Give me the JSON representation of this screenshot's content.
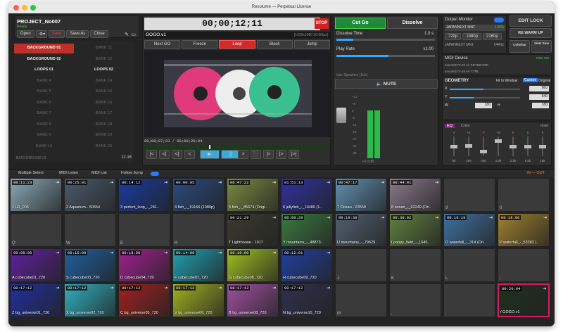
{
  "window": {
    "title": "Resolume — Perpetual License"
  },
  "project": {
    "name": "PROJECT_No007",
    "status": "Ready",
    "buttons": [
      "Open",
      "Save",
      "Save As",
      "Close"
    ]
  },
  "banks": {
    "left": [
      "BACKGROUND 01",
      "BACKGROUND 02",
      "LOOPS 01",
      "BANK 4",
      "BANK 5",
      "BANK 6",
      "BANK 7",
      "BANK 8",
      "BANK 9",
      "BANK 10"
    ],
    "right": [
      "BANK 11",
      "BANK 12",
      "LOOPS 02",
      "BANK 14",
      "BANK 15",
      "BANK 16",
      "BANK 17",
      "BANK 18",
      "BANK 19",
      "BANK 20"
    ],
    "footer_left": "BACKGROUND 01",
    "footer_right": "11:16"
  },
  "preview": {
    "timecode": "00;00;12;11",
    "stop": "STOP",
    "clip": "GOGO.v1",
    "res": "[1920x1080 30.00fps]",
    "modes": [
      "Next GO",
      "Freeze",
      "Loop",
      "Black",
      "Jump"
    ],
    "position": "00;00;07;23 / 00;00;20;04"
  },
  "transport": [
    "|<",
    "<|",
    "<|",
    "<",
    "▶",
    "||",
    ">",
    "⬛",
    "|>",
    "|>",
    "|>|"
  ],
  "cut": {
    "cut_go": "Cut Go",
    "dissolve": "Dissolve",
    "dissolve_time_label": "Dissolve Time",
    "dissolve_time": "1.0 s",
    "play_rate_label": "Play Rate",
    "play_rate": "x1.00",
    "use_speakers": "Use Speakers (1ch)",
    "mute": "MUTE",
    "db_scale": [
      "+12",
      "+6",
      "0",
      "-6",
      "-12",
      "-18",
      "-24",
      "-36",
      "-48"
    ],
    "db_val": "+0.0 dB"
  },
  "output": {
    "title": "Output Monitor",
    "device": "JAPANNEXT MNT",
    "status": "100%",
    "sizes": [
      "720p",
      "1080p",
      "2160p"
    ],
    "device2": "JAPANNEXT MNT",
    "hz": "144Hz",
    "right_buttons": [
      "EDIT LOCK",
      "RE WARM UP",
      "Colorbar",
      "1kHz Sine"
    ]
  },
  "midi": {
    "title": "MIDI Device",
    "dev1": "microKEY2-25 Air KEYBOARD",
    "dev2": "microKEY2-25 Air CTRL",
    "badge": "MIDI SW"
  },
  "geometry": {
    "title": "GEOMETRY",
    "modes": [
      "Fit to Window",
      "Custom",
      "Original"
    ],
    "x_label": "X",
    "x": "960",
    "y_label": "Y",
    "y": "540",
    "w_label": "W",
    "w": "180",
    "h_label": "H",
    "h": "180"
  },
  "eq": {
    "title": "EQ",
    "color": "Color",
    "reset": "reset",
    "bands": [
      "60",
      "150",
      "400",
      "1.0k",
      "2.5k",
      "6.0k",
      "15k"
    ],
    "vals": [
      "0",
      "+4",
      "-7",
      "+8",
      "0",
      "0",
      "0"
    ],
    "levels": [
      0.5,
      0.55,
      0.25,
      0.8,
      0.5,
      0.5,
      0.5
    ]
  },
  "toolbar": {
    "multi_select": "Multiple Select",
    "midi_learn": "MIDI Learn",
    "midi_list": "MIDI List",
    "follow_jump": "Follow Jump",
    "in_out": "IN — OUT"
  },
  "grid": [
    {
      "tc": "00:11:23",
      "name": "1 H1_006",
      "c": "#8aa9b8"
    },
    {
      "tc": "00:25:01",
      "name": "2 Aquarium - 50654",
      "c": "#4a5a6a"
    },
    {
      "tc": "00:14:12",
      "name": "3 perfect_loop_-_241..",
      "c": "#1a3aa0"
    },
    {
      "tc": "00:00:05",
      "name": "4 fish_-_19166 (1080p)",
      "c": "#2a4a80"
    },
    {
      "tc": "00:47:22",
      "name": "5 fish_-_85674 (Origi..",
      "c": "#7a8a40"
    },
    {
      "tc": "01:51:13",
      "name": "6 jellyfish_-_10480 (1..",
      "c": "#3030a0"
    },
    {
      "tc": "00:47:17",
      "name": "7 Ocean - 63559",
      "c": "#6090b0"
    },
    {
      "tc": "00:44:01",
      "name": "8 ocean_-_62249 (Ori..",
      "c": "#8a7a8a"
    },
    {
      "tc": "",
      "name": "9",
      "c": ""
    },
    {
      "tc": "",
      "name": "0",
      "c": ""
    },
    {
      "tc": "",
      "name": "Q",
      "c": ""
    },
    {
      "tc": "",
      "name": "W",
      "c": ""
    },
    {
      "tc": "",
      "name": "E",
      "c": ""
    },
    {
      "tc": "",
      "name": "R",
      "c": ""
    },
    {
      "tc": "00:21:29",
      "name": "T Lighthouse - 1917",
      "c": "#3a3a30"
    },
    {
      "tc": "00:09:28",
      "name": "Y mountains_-_48873..",
      "c": "#3a7a40"
    },
    {
      "tc": "00:19:38",
      "name": "U mountains_-_79629..",
      "c": "#506070"
    },
    {
      "tc": "00:30:02",
      "name": "I poppy_field_-_1645..",
      "c": "#608040"
    },
    {
      "tc": "00:16:19",
      "name": "O waterfall_-_314 (Ori..",
      "c": "#4070a0"
    },
    {
      "tc": "00:18:00",
      "name": "P waterfall_-_53383 (..",
      "c": "#a08030"
    },
    {
      "tc": "00:08:00",
      "name": "A cubecube01_720",
      "c": "#6020a0"
    },
    {
      "tc": "00:15:00",
      "name": "S cubecube03_720",
      "c": "#2060a0"
    },
    {
      "tc": "00:18:00",
      "name": "D cubecube04_720",
      "c": "#a02090"
    },
    {
      "tc": "00:14:00",
      "name": "F cubecube07_720",
      "c": "#20a0b0"
    },
    {
      "tc": "00:10:00",
      "name": "G cubecube08_720",
      "c": "#a0c020"
    },
    {
      "tc": "00:12:01",
      "name": "H cubecube09_720",
      "c": "#2040a0"
    },
    {
      "tc": "",
      "name": "J",
      "c": ""
    },
    {
      "tc": "",
      "name": "K",
      "c": ""
    },
    {
      "tc": "",
      "name": "L",
      "c": ""
    },
    {
      "tc": "",
      "name": ";",
      "c": ""
    },
    {
      "tc": "00:17:12",
      "name": "Z bg_universe01_720",
      "c": "#2030a0"
    },
    {
      "tc": "00:17:12",
      "name": "X bg_universe02_720",
      "c": "#30b0c0"
    },
    {
      "tc": "00:17:12",
      "name": "C bg_universe05_720",
      "c": "#a02020"
    },
    {
      "tc": "00:17:12",
      "name": "V bg_universe06_720",
      "c": "#a0b020"
    },
    {
      "tc": "00:17:12",
      "name": "B bg_universe08_720",
      "c": "#a050a0"
    },
    {
      "tc": "00:17:12",
      "name": "N bg_universe10_720",
      "c": "#303050"
    },
    {
      "tc": "",
      "name": "M",
      "c": ""
    },
    {
      "tc": "",
      "name": ",",
      "c": ""
    },
    {
      "tc": "",
      "name": ".",
      "c": ""
    },
    {
      "tc": "00:20;04",
      "name": "/ GOGO.v1",
      "c": "#203020"
    }
  ]
}
